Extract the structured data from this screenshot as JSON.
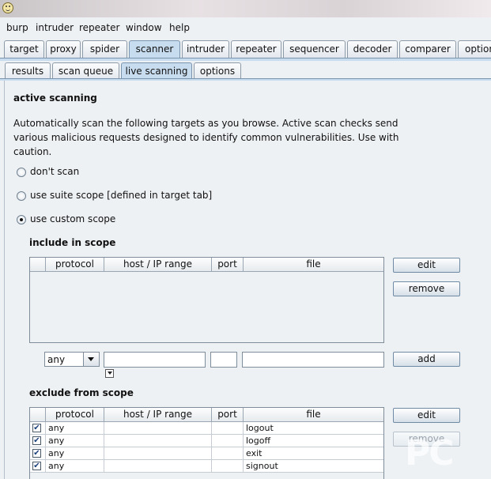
{
  "menu": [
    "burp",
    "intruder",
    "repeater",
    "window",
    "help"
  ],
  "main_tabs": [
    "target",
    "proxy",
    "spider",
    "scanner",
    "intruder",
    "repeater",
    "sequencer",
    "decoder",
    "comparer",
    "options"
  ],
  "sub_tabs": [
    "results",
    "scan queue",
    "live scanning",
    "options"
  ],
  "section": {
    "heading": "active scanning",
    "desc_line1": "Automatically scan the following targets as you browse. Active scan checks send",
    "desc_line2": "various malicious requests designed to identify common vulnerabilities. Use with",
    "desc_line3": "caution."
  },
  "radios": {
    "dont_scan": "don't scan",
    "suite_scope": "use suite scope [defined in target tab]",
    "custom_scope": "use custom scope",
    "selected": "custom_scope"
  },
  "columns": [
    "protocol",
    "host / IP range",
    "port",
    "file"
  ],
  "include": {
    "heading": "include in scope",
    "edit": "edit",
    "remove": "remove",
    "add": "add",
    "protocol_value": "any"
  },
  "exclude": {
    "heading": "exclude from scope",
    "edit": "edit",
    "remove": "remove",
    "rows": [
      {
        "checked": true,
        "protocol": "any",
        "host": "",
        "port": "",
        "file": "logout"
      },
      {
        "checked": true,
        "protocol": "any",
        "host": "",
        "port": "",
        "file": "logoff"
      },
      {
        "checked": true,
        "protocol": "any",
        "host": "",
        "port": "",
        "file": "exit"
      },
      {
        "checked": true,
        "protocol": "any",
        "host": "",
        "port": "",
        "file": "signout"
      }
    ]
  },
  "watermark": "PC",
  "colors": {
    "active_tab": "#c8dcef",
    "background": "#eef1f4"
  }
}
